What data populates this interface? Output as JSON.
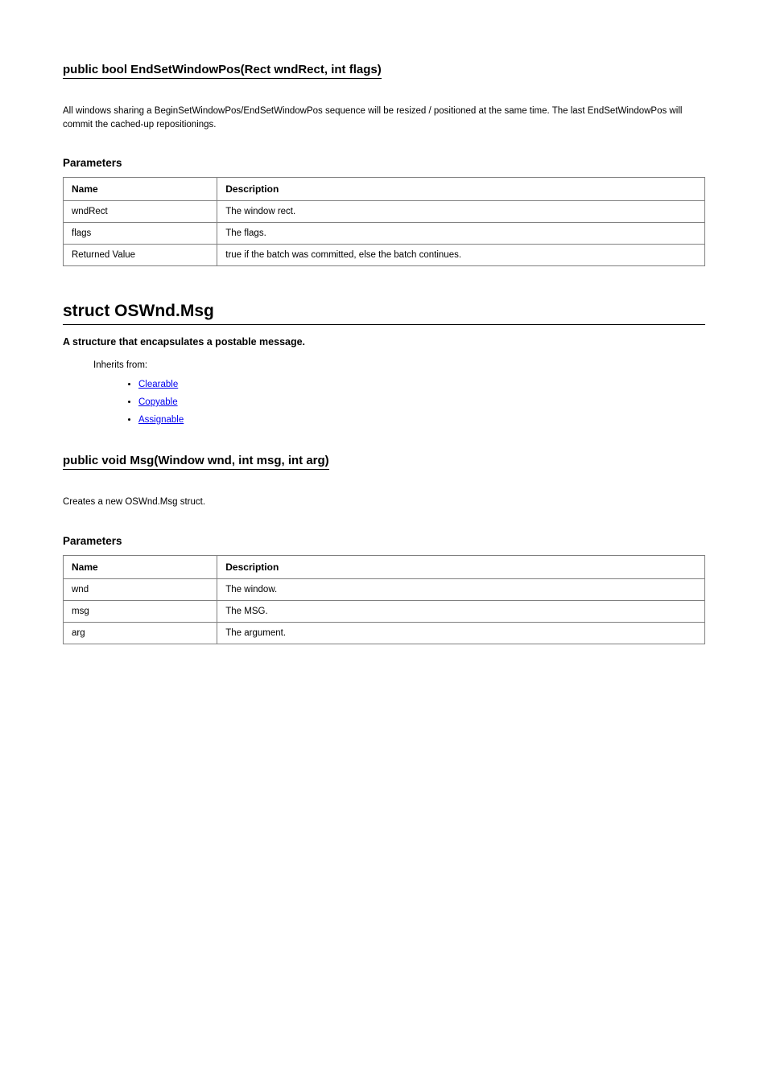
{
  "rule1": {
    "title": "public bool EndSetWindowPos(Rect wndRect, int flags)",
    "notes": "All windows sharing a BeginSetWindowPos/EndSetWindowPos sequence will be resized / positioned at the same time. The last EndSetWindowPos will commit the cached-up repositionings.",
    "params_title": "Parameters",
    "headers": [
      "Name",
      "Description"
    ],
    "rows": [
      [
        "wndRect",
        "The window rect."
      ],
      [
        "flags",
        "The flags."
      ],
      [
        "Returned Value",
        "true if the batch was committed, else the batch continues."
      ]
    ]
  },
  "struct": {
    "title": "struct OSWnd.Msg",
    "sub": "A structure that encapsulates a postable message.",
    "inherits_label": "Inherits from:",
    "inherits": [
      {
        "label": "Clearable",
        "href": "#"
      },
      {
        "label": "Copyable",
        "href": "#"
      },
      {
        "label": "Assignable",
        "href": "#"
      }
    ]
  },
  "rule2": {
    "title": "public void Msg(Window wnd, int msg, int arg)",
    "notes": "Creates a new OSWnd.Msg struct.",
    "params_title": "Parameters",
    "headers": [
      "Name",
      "Description"
    ],
    "rows": [
      [
        "wnd",
        "The window."
      ],
      [
        "msg",
        "The MSG."
      ],
      [
        "arg",
        "The argument."
      ]
    ]
  }
}
